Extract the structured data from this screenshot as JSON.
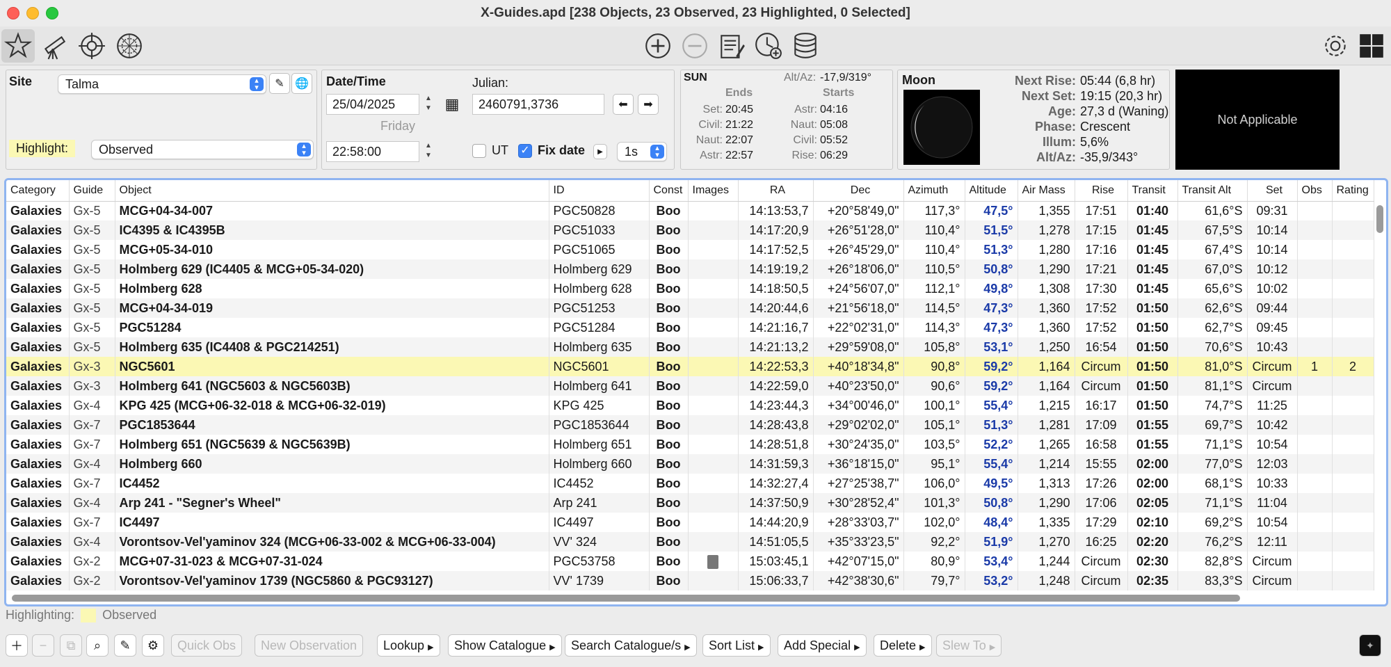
{
  "window": {
    "title": "X-Guides.apd [238 Objects, 23 Observed, 23 Highlighted, 0 Selected]"
  },
  "toolbar": {
    "left_icons": [
      "star-icon",
      "telescope-icon",
      "crosshair-icon",
      "reticle-icon"
    ],
    "center_icons": [
      "add-circle-icon",
      "remove-circle-icon",
      "notes-icon",
      "clock-add-icon",
      "database-icon"
    ],
    "right_icons": [
      "gear-icon",
      "grid-icon"
    ]
  },
  "site": {
    "label": "Site",
    "value": "Talma",
    "highlight_label": "Highlight:",
    "highlight_value": "Observed"
  },
  "datetime": {
    "label": "Date/Time",
    "date": "25/04/2025",
    "weekday": "Friday",
    "time": "22:58:00",
    "julian_label": "Julian:",
    "julian": "2460791,3736",
    "ut_label": "UT",
    "fixdate_label": "Fix date",
    "step": "1s"
  },
  "sun": {
    "label": "SUN",
    "altaz_label": "Alt/Az:",
    "altaz": "-17,9/319°",
    "ends_label": "Ends",
    "starts_label": "Starts",
    "ends": [
      {
        "k": "Set:",
        "v": "20:45"
      },
      {
        "k": "Civil:",
        "v": "21:22"
      },
      {
        "k": "Naut:",
        "v": "22:07"
      },
      {
        "k": "Astr:",
        "v": "22:57"
      }
    ],
    "starts": [
      {
        "k": "Astr:",
        "v": "04:16"
      },
      {
        "k": "Naut:",
        "v": "05:08"
      },
      {
        "k": "Civil:",
        "v": "05:52"
      },
      {
        "k": "Rise:",
        "v": "06:29"
      }
    ]
  },
  "moon": {
    "label": "Moon",
    "rows": [
      {
        "k": "Next Rise:",
        "v": "05:44 (6,8 hr)"
      },
      {
        "k": "Next Set:",
        "v": "19:15 (20,3 hr)"
      },
      {
        "k": "Age:",
        "v": "27,3 d (Waning)"
      },
      {
        "k": "Phase:",
        "v": "Crescent"
      },
      {
        "k": "Illum:",
        "v": "5,6%"
      },
      {
        "k": "Alt/Az:",
        "v": "-35,9/343°"
      }
    ]
  },
  "not_applicable": "Not Applicable",
  "table": {
    "columns": [
      "Category",
      "Guide",
      "Object",
      "ID",
      "Const",
      "Images",
      "RA",
      "Dec",
      "Azimuth",
      "Altitude",
      "Air Mass",
      "Rise",
      "Transit",
      "Transit Alt",
      "Set",
      "Obs",
      "Rating"
    ],
    "rows": [
      [
        "Galaxies",
        "Gx-5",
        "MCG+04-34-007",
        "PGC50828",
        "Boo",
        "",
        "14:13:53,7",
        "+20°58'49,0\"",
        "117,3°",
        "47,5°",
        "1,355",
        "17:51",
        "01:40",
        "61,6°S",
        "09:31",
        "",
        ""
      ],
      [
        "Galaxies",
        "Gx-5",
        "IC4395 & IC4395B",
        "PGC51033",
        "Boo",
        "",
        "14:17:20,9",
        "+26°51'28,0\"",
        "110,4°",
        "51,5°",
        "1,278",
        "17:15",
        "01:45",
        "67,5°S",
        "10:14",
        "",
        ""
      ],
      [
        "Galaxies",
        "Gx-5",
        "MCG+05-34-010",
        "PGC51065",
        "Boo",
        "",
        "14:17:52,5",
        "+26°45'29,0\"",
        "110,4°",
        "51,3°",
        "1,280",
        "17:16",
        "01:45",
        "67,4°S",
        "10:14",
        "",
        ""
      ],
      [
        "Galaxies",
        "Gx-5",
        "Holmberg 629 (IC4405 & MCG+05-34-020)",
        "Holmberg 629",
        "Boo",
        "",
        "14:19:19,2",
        "+26°18'06,0\"",
        "110,5°",
        "50,8°",
        "1,290",
        "17:21",
        "01:45",
        "67,0°S",
        "10:12",
        "",
        ""
      ],
      [
        "Galaxies",
        "Gx-5",
        "Holmberg 628",
        "Holmberg 628",
        "Boo",
        "",
        "14:18:50,5",
        "+24°56'07,0\"",
        "112,1°",
        "49,8°",
        "1,308",
        "17:30",
        "01:45",
        "65,6°S",
        "10:02",
        "",
        ""
      ],
      [
        "Galaxies",
        "Gx-5",
        "MCG+04-34-019",
        "PGC51253",
        "Boo",
        "",
        "14:20:44,6",
        "+21°56'18,0\"",
        "114,5°",
        "47,3°",
        "1,360",
        "17:52",
        "01:50",
        "62,6°S",
        "09:44",
        "",
        ""
      ],
      [
        "Galaxies",
        "Gx-5",
        "PGC51284",
        "PGC51284",
        "Boo",
        "",
        "14:21:16,7",
        "+22°02'31,0\"",
        "114,3°",
        "47,3°",
        "1,360",
        "17:52",
        "01:50",
        "62,7°S",
        "09:45",
        "",
        ""
      ],
      [
        "Galaxies",
        "Gx-5",
        "Holmberg 635 (IC4408 & PGC214251)",
        "Holmberg 635",
        "Boo",
        "",
        "14:21:13,2",
        "+29°59'08,0\"",
        "105,8°",
        "53,1°",
        "1,250",
        "16:54",
        "01:50",
        "70,6°S",
        "10:43",
        "",
        ""
      ],
      [
        "Galaxies",
        "Gx-3",
        "NGC5601",
        "NGC5601",
        "Boo",
        "",
        "14:22:53,3",
        "+40°18'34,8\"",
        "90,8°",
        "59,2°",
        "1,164",
        "Circum",
        "01:50",
        "81,0°S",
        "Circum",
        "1",
        "2"
      ],
      [
        "Galaxies",
        "Gx-3",
        "Holmberg 641 (NGC5603 & NGC5603B)",
        "Holmberg 641",
        "Boo",
        "",
        "14:22:59,0",
        "+40°23'50,0\"",
        "90,6°",
        "59,2°",
        "1,164",
        "Circum",
        "01:50",
        "81,1°S",
        "Circum",
        "",
        ""
      ],
      [
        "Galaxies",
        "Gx-4",
        "KPG 425 (MCG+06-32-018 & MCG+06-32-019)",
        "KPG 425",
        "Boo",
        "",
        "14:23:44,3",
        "+34°00'46,0\"",
        "100,1°",
        "55,4°",
        "1,215",
        "16:17",
        "01:50",
        "74,7°S",
        "11:25",
        "",
        ""
      ],
      [
        "Galaxies",
        "Gx-7",
        "PGC1853644",
        "PGC1853644",
        "Boo",
        "",
        "14:28:43,8",
        "+29°02'02,0\"",
        "105,1°",
        "51,3°",
        "1,281",
        "17:09",
        "01:55",
        "69,7°S",
        "10:42",
        "",
        ""
      ],
      [
        "Galaxies",
        "Gx-7",
        "Holmberg 651 (NGC5639 & NGC5639B)",
        "Holmberg 651",
        "Boo",
        "",
        "14:28:51,8",
        "+30°24'35,0\"",
        "103,5°",
        "52,2°",
        "1,265",
        "16:58",
        "01:55",
        "71,1°S",
        "10:54",
        "",
        ""
      ],
      [
        "Galaxies",
        "Gx-4",
        "Holmberg 660",
        "Holmberg 660",
        "Boo",
        "",
        "14:31:59,3",
        "+36°18'15,0\"",
        "95,1°",
        "55,4°",
        "1,214",
        "15:55",
        "02:00",
        "77,0°S",
        "12:03",
        "",
        ""
      ],
      [
        "Galaxies",
        "Gx-7",
        "IC4452",
        "IC4452",
        "Boo",
        "",
        "14:32:27,4",
        "+27°25'38,7\"",
        "106,0°",
        "49,5°",
        "1,313",
        "17:26",
        "02:00",
        "68,1°S",
        "10:33",
        "",
        ""
      ],
      [
        "Galaxies",
        "Gx-4",
        "Arp 241 - \"Segner's Wheel\"",
        "Arp 241",
        "Boo",
        "",
        "14:37:50,9",
        "+30°28'52,4\"",
        "101,3°",
        "50,8°",
        "1,290",
        "17:06",
        "02:05",
        "71,1°S",
        "11:04",
        "",
        ""
      ],
      [
        "Galaxies",
        "Gx-7",
        "IC4497",
        "IC4497",
        "Boo",
        "",
        "14:44:20,9",
        "+28°33'03,7\"",
        "102,0°",
        "48,4°",
        "1,335",
        "17:29",
        "02:10",
        "69,2°S",
        "10:54",
        "",
        ""
      ],
      [
        "Galaxies",
        "Gx-4",
        "Vorontsov-Vel'yaminov 324 (MCG+06-33-002 & MCG+06-33-004)",
        "VV' 324",
        "Boo",
        "",
        "14:51:05,5",
        "+35°33'23,5\"",
        "92,2°",
        "51,9°",
        "1,270",
        "16:25",
        "02:20",
        "76,2°S",
        "12:11",
        "",
        ""
      ],
      [
        "Galaxies",
        "Gx-2",
        "MCG+07-31-023 & MCG+07-31-024",
        "PGC53758",
        "Boo",
        "image",
        "15:03:45,1",
        "+42°07'15,0\"",
        "80,9°",
        "53,4°",
        "1,244",
        "Circum",
        "02:30",
        "82,8°S",
        "Circum",
        "",
        ""
      ],
      [
        "Galaxies",
        "Gx-2",
        "Vorontsov-Vel'yaminov 1739 (NGC5860 & PGC93127)",
        "VV' 1739",
        "Boo",
        "",
        "15:06:33,7",
        "+42°38'30,6\"",
        "79,7°",
        "53,2°",
        "1,248",
        "Circum",
        "02:35",
        "83,3°S",
        "Circum",
        "",
        ""
      ]
    ],
    "highlighted_row": 8
  },
  "legend": {
    "label": "Highlighting:",
    "value": "Observed",
    "color": "#fbf8b4"
  },
  "bottom": {
    "quick_obs": "Quick Obs",
    "new_observation": "New Observation",
    "lookup": "Lookup",
    "show_catalogue": "Show Catalogue",
    "search_catalogue": "Search Catalogue/s",
    "sort_list": "Sort List",
    "add_special": "Add Special",
    "delete": "Delete",
    "slew_to": "Slew To"
  },
  "colors": {
    "accent": "#3b82f6",
    "altitude_text": "#1a3aa8",
    "highlight": "#fbf8b4"
  }
}
